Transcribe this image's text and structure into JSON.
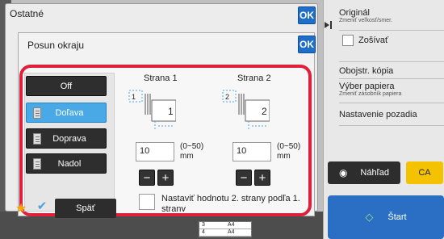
{
  "outer_dialog": {
    "title": "Ostatné",
    "ok_label": "OK"
  },
  "inner_dialog": {
    "title": "Posun okraju",
    "ok_label": "OK"
  },
  "options": [
    "Off",
    "Doľava",
    "Doprava",
    "Nadol"
  ],
  "selected_option": "Doľava",
  "side1": {
    "title": "Strana 1",
    "value": "10",
    "range": "(0~50)",
    "unit": "mm",
    "page_num": "1"
  },
  "side2": {
    "title": "Strana 2",
    "value": "10",
    "range": "(0~50)",
    "unit": "mm",
    "page_num": "2"
  },
  "stepper": {
    "minus": "−",
    "plus": "+"
  },
  "checkbox_label_line1": "Nastaviť hodnotu 2. strany podľa 1.",
  "checkbox_label_line2": "strany",
  "right_panel": {
    "original_main": "Originál",
    "original_sub": "Zmeniť veľkosť/smer.",
    "staple": "Zošívať",
    "duplex": "Obojstr. kópia",
    "paper_main": "Výber papiera",
    "paper_sub": "Zmeniť zásobník papiera",
    "background": "Nastavenie pozadia"
  },
  "buttons": {
    "preview": "Náhľad",
    "ca": "CA",
    "start": "Štart",
    "back": "Späť"
  },
  "mini_table": [
    {
      "num": "3",
      "size": "A4"
    },
    {
      "num": "4",
      "size": "A4"
    }
  ],
  "colors": {
    "accent_blue": "#1f6fc9",
    "selected": "#48a9e6",
    "highlight_red": "#e0203a",
    "ca_yellow": "#f5c200",
    "start_blue": "#2a6fc4"
  }
}
